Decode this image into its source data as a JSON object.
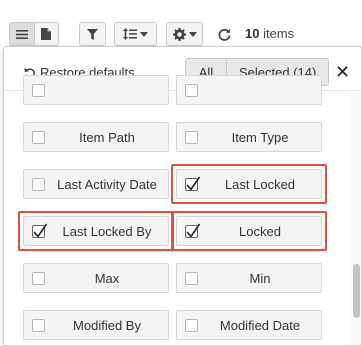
{
  "toolbar": {
    "view_list_icon": "list-icon",
    "view_doc_icon": "document-icon",
    "filter_icon": "filter-icon",
    "sort_icon": "sort-icon",
    "settings_icon": "gear-icon",
    "refresh_icon": "refresh-icon",
    "items_count": "10",
    "items_suffix": " items"
  },
  "panel": {
    "restore_label": "Restore defaults",
    "filter_all": "All",
    "filter_selected": "Selected (14)",
    "close_label": "✕",
    "highlight_color": "#d9553a"
  },
  "options": [
    {
      "label": "",
      "checked": false
    },
    {
      "label": "",
      "checked": false
    },
    {
      "label": "Item Path",
      "checked": false
    },
    {
      "label": "Item Type",
      "checked": false
    },
    {
      "label": "Last Activity Date",
      "checked": false
    },
    {
      "label": "Last Locked",
      "checked": true
    },
    {
      "label": "Last Locked By",
      "checked": true
    },
    {
      "label": "Locked",
      "checked": true
    },
    {
      "label": "Max",
      "checked": false
    },
    {
      "label": "Min",
      "checked": false
    },
    {
      "label": "Modified By",
      "checked": false
    },
    {
      "label": "Modified Date",
      "checked": false
    }
  ]
}
